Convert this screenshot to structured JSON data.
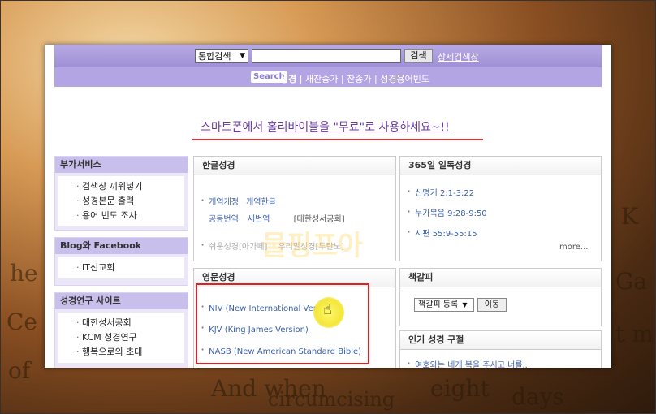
{
  "header": {
    "search_type": "통합검색",
    "search_button": "검색",
    "advanced_search_link": "상세검색창",
    "search_logo": "Search",
    "nav": [
      "성경",
      "새찬송가",
      "찬송가",
      "성경용어빈도"
    ]
  },
  "banner": {
    "text": "스마트폰에서 홀리바이블을 \"무료\"로 사용하세요~!!"
  },
  "sidebar": {
    "extra_services": {
      "title": "부가서비스",
      "items": [
        "검색창 끼워넣기",
        "성경본문 출력",
        "용어 빈도 조사"
      ]
    },
    "blog_facebook": {
      "title": "Blog와 Facebook",
      "items": [
        "IT선교회"
      ]
    },
    "research_sites": {
      "title": "성경연구 사이트",
      "items": [
        "대한성서공회",
        "KCM 성경연구",
        "행복으로의 초대"
      ]
    }
  },
  "korean_bible": {
    "title": "한글성경",
    "links": [
      "개역개정",
      "개역한글",
      "공동번역",
      "새번역"
    ],
    "publisher": "[대한성서공회]",
    "gray_links": [
      "쉬운성경[아가페]",
      "우리말성경[두란노]"
    ]
  },
  "reading_365": {
    "title": "365일 일독성경",
    "items": [
      "신명기 2:1-3:22",
      "누가복음 9:28-9:50",
      "시편 55:9-55:15"
    ],
    "more": "more..."
  },
  "english_bible": {
    "title": "영문성경",
    "items": [
      "NIV (New International Version)",
      "KJV (King James Version)",
      "NASB (New American Standard Bible)"
    ]
  },
  "bookmark": {
    "title": "책갈피",
    "select": "책갈피 등록",
    "move_button": "이동"
  },
  "popular_verses": {
    "title": "인기 성경 구절",
    "items": [
      "여호와는 네게 복을 주시고 너를..."
    ]
  },
  "watermark": "물핑프아",
  "background_text": [
    "Ce",
    "of",
    "he",
    "And when",
    "circumcising",
    "eight",
    "days",
    "K",
    "Ga",
    "t m"
  ]
}
